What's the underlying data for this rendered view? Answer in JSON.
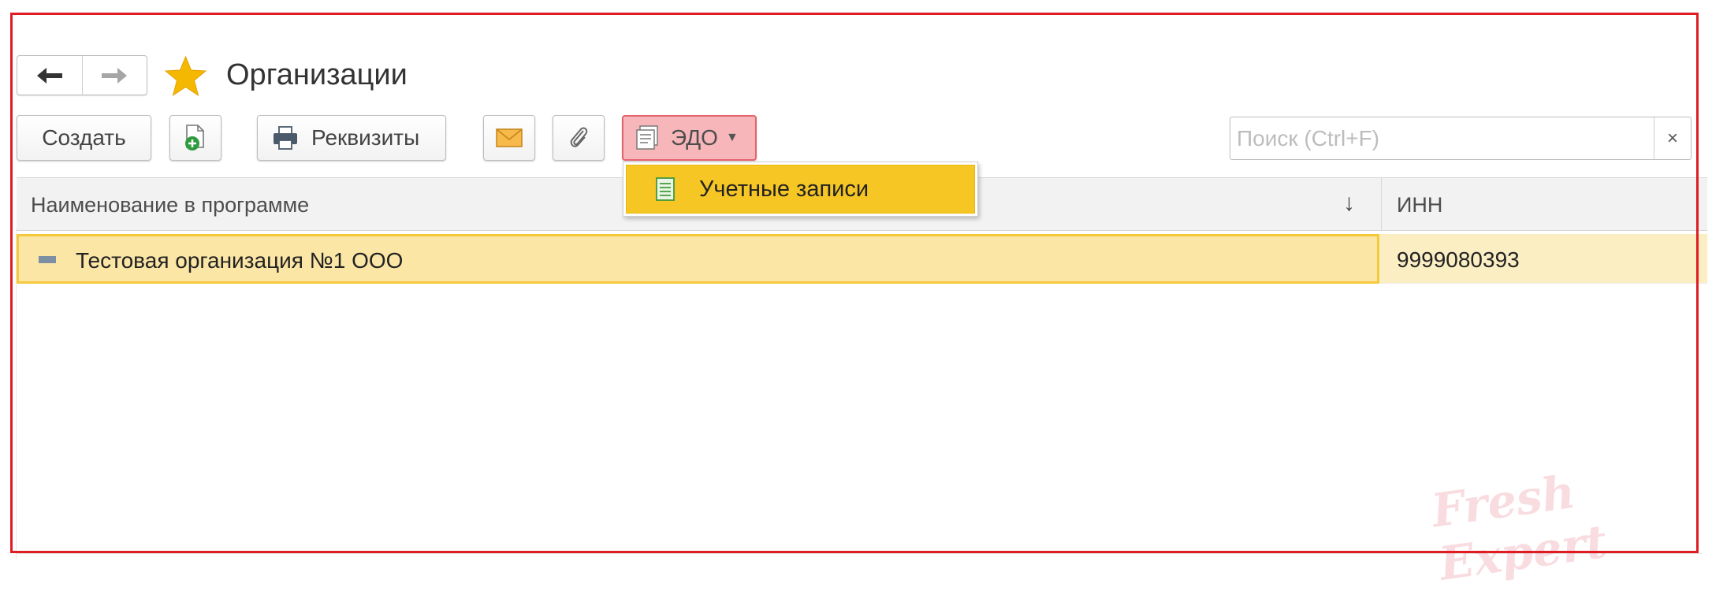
{
  "header": {
    "title": "Организации",
    "back_icon": "arrow-left-icon",
    "forward_icon": "arrow-right-icon",
    "favorite_icon": "star-icon",
    "favorite_color": "#f5b800"
  },
  "toolbar": {
    "create_label": "Создать",
    "add_from_file_icon": "document-add-icon",
    "print_icon": "printer-icon",
    "requisites_label": "Реквизиты",
    "mail_icon": "envelope-icon",
    "attach_icon": "paperclip-icon",
    "edo_icon": "edo-documents-icon",
    "edo_label": "ЭДО",
    "edo_highlight_color": "#f7b6b9"
  },
  "search": {
    "placeholder": "Поиск (Ctrl+F)",
    "value": "",
    "clear_label": "×"
  },
  "dropdown": {
    "items": [
      {
        "label": "Учетные записи",
        "icon": "sheet-icon"
      }
    ],
    "highlight_color": "#f6c624"
  },
  "table": {
    "columns": [
      "Наименование в программе",
      "ИНН"
    ],
    "sort_indicator": "↓",
    "rows": [
      {
        "name": "Тестовая организация №1 ООО",
        "inn": "9999080393",
        "icon": "minus-icon"
      }
    ],
    "selected_row_color": "#fbe6a6"
  },
  "watermark": {
    "text": "Fresh Expert"
  },
  "frame_color": "#e11b22"
}
